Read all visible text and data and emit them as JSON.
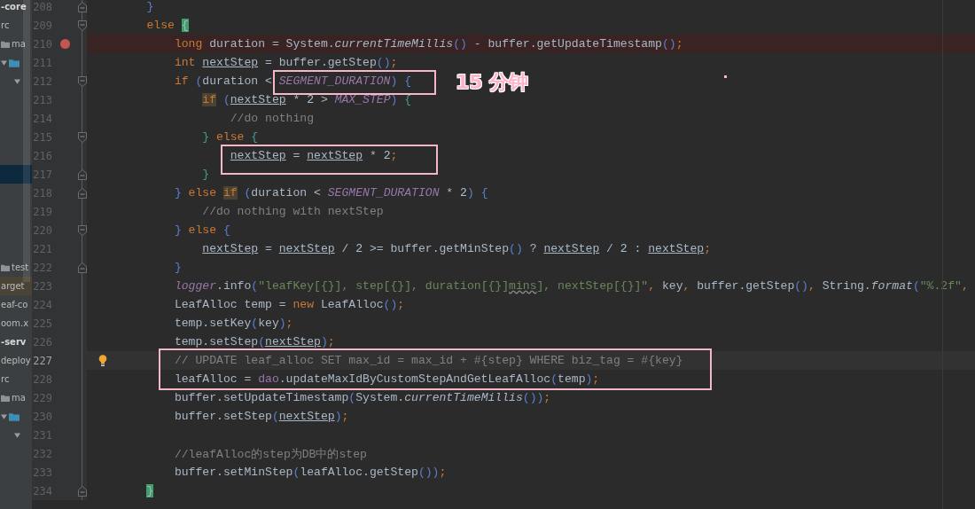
{
  "project_tree": [
    {
      "kind": "node",
      "text": "-core",
      "bold": true,
      "selected": false,
      "excluded": false
    },
    {
      "kind": "node",
      "text": "rc",
      "bold": false,
      "selected": false,
      "excluded": false
    },
    {
      "kind": "folder",
      "text": "ma",
      "bold": false,
      "selected": false,
      "excluded": false
    },
    {
      "kind": "expanded-folder",
      "selected": false,
      "excluded": false
    },
    {
      "kind": "expander",
      "selected": false,
      "excluded": false
    },
    {
      "kind": "blank",
      "selected": false,
      "excluded": false
    },
    {
      "kind": "blank",
      "selected": false,
      "excluded": false
    },
    {
      "kind": "blank",
      "selected": false,
      "excluded": false
    },
    {
      "kind": "blank",
      "selected": false,
      "excluded": false
    },
    {
      "kind": "blank",
      "selected": true,
      "excluded": false
    },
    {
      "kind": "blank",
      "selected": false,
      "excluded": false
    },
    {
      "kind": "blank",
      "selected": false,
      "excluded": false
    },
    {
      "kind": "blank",
      "selected": false,
      "excluded": false
    },
    {
      "kind": "blank",
      "selected": false,
      "excluded": false
    },
    {
      "kind": "folder",
      "text": "test",
      "bold": false,
      "selected": false,
      "excluded": false
    },
    {
      "kind": "node",
      "text": "arget",
      "bold": false,
      "selected": false,
      "excluded": true
    },
    {
      "kind": "node",
      "text": "eaf-co",
      "bold": false,
      "selected": false,
      "excluded": false
    },
    {
      "kind": "node",
      "text": "oom.x",
      "bold": false,
      "selected": false,
      "excluded": false
    },
    {
      "kind": "node",
      "text": "-serv",
      "bold": true,
      "selected": false,
      "excluded": false
    },
    {
      "kind": "node",
      "text": "deploy",
      "bold": false,
      "selected": false,
      "excluded": false
    },
    {
      "kind": "node",
      "text": "rc",
      "bold": false,
      "selected": false,
      "excluded": false
    },
    {
      "kind": "folder",
      "text": "ma",
      "bold": false,
      "selected": false,
      "excluded": false
    },
    {
      "kind": "expanded-folder",
      "selected": false,
      "excluded": false
    },
    {
      "kind": "expander",
      "selected": false,
      "excluded": false
    }
  ],
  "editor": {
    "lines": [
      {
        "number": "208",
        "fold_start": false,
        "fold_end": true,
        "tokens": [
          {
            "text": "    }",
            "kind": "bracket"
          }
        ]
      },
      {
        "number": "209",
        "fold_start": true,
        "fold_end": false,
        "tokens": [
          {
            "text": "    else ",
            "kind": "kw"
          },
          {
            "text": "{",
            "kind": "match"
          }
        ]
      },
      {
        "number": "210",
        "fold_start": false,
        "fold_end": false,
        "breakpoint": true,
        "tokens": [
          {
            "text": "        long",
            "kind": "kw"
          },
          {
            "text": " duration = System.",
            "kind": "plain"
          },
          {
            "text": "currentTimeMillis",
            "kind": "static"
          },
          {
            "text": "()",
            "kind": "bracket"
          },
          {
            "text": " - buffer.getUpdateTimestamp",
            "kind": "plain"
          },
          {
            "text": "()",
            "kind": "bracket"
          },
          {
            "text": ";",
            "kind": "punct"
          }
        ]
      },
      {
        "number": "211",
        "fold_start": false,
        "fold_end": false,
        "tokens": [
          {
            "text": "        int ",
            "kind": "kw"
          },
          {
            "text": "nextStep",
            "kind": "var"
          },
          {
            "text": " = buffer.getStep",
            "kind": "plain"
          },
          {
            "text": "()",
            "kind": "bracket"
          },
          {
            "text": ";",
            "kind": "punct"
          }
        ]
      },
      {
        "number": "212",
        "fold_start": true,
        "fold_end": false,
        "tokens": [
          {
            "text": "        if ",
            "kind": "kw"
          },
          {
            "text": "(",
            "kind": "bracket"
          },
          {
            "text": "duration < ",
            "kind": "plain"
          },
          {
            "text": "SEGMENT_DURATION",
            "kind": "const"
          },
          {
            "text": ")",
            "kind": "bracket"
          },
          {
            "text": " {",
            "kind": "bracket"
          }
        ]
      },
      {
        "number": "213",
        "fold_start": false,
        "fold_end": false,
        "tokens": [
          {
            "text": "            if",
            "kind": "kwhl"
          },
          {
            "text": " (",
            "kind": "bracket"
          },
          {
            "text": "nextStep",
            "kind": "var"
          },
          {
            "text": " * ",
            "kind": "plain"
          },
          {
            "text": "2",
            "kind": "num"
          },
          {
            "text": " > ",
            "kind": "plain"
          },
          {
            "text": "MAX_STEP",
            "kind": "const"
          },
          {
            "text": ")",
            "kind": "bracket"
          },
          {
            "text": " {",
            "kind": "green"
          }
        ]
      },
      {
        "number": "214",
        "fold_start": false,
        "fold_end": false,
        "tokens": [
          {
            "text": "                //do nothing",
            "kind": "comment"
          }
        ]
      },
      {
        "number": "215",
        "fold_start": true,
        "fold_end": false,
        "tokens": [
          {
            "text": "            }",
            "kind": "green"
          },
          {
            "text": " else ",
            "kind": "kw"
          },
          {
            "text": "{",
            "kind": "green"
          }
        ]
      },
      {
        "number": "216",
        "fold_start": false,
        "fold_end": false,
        "tokens": [
          {
            "text": "                nextStep",
            "kind": "var"
          },
          {
            "text": " = ",
            "kind": "plain"
          },
          {
            "text": "nextStep",
            "kind": "var"
          },
          {
            "text": " * ",
            "kind": "plain"
          },
          {
            "text": "2",
            "kind": "num"
          },
          {
            "text": ";",
            "kind": "punct"
          }
        ]
      },
      {
        "number": "217",
        "fold_start": false,
        "fold_end": true,
        "tokens": [
          {
            "text": "            }",
            "kind": "green"
          }
        ]
      },
      {
        "number": "218",
        "fold_start": false,
        "fold_end": true,
        "tokens": [
          {
            "text": "        } ",
            "kind": "bracket"
          },
          {
            "text": "else ",
            "kind": "kw"
          },
          {
            "text": "if",
            "kind": "kwhl"
          },
          {
            "text": " (",
            "kind": "bracket"
          },
          {
            "text": "duration < ",
            "kind": "plain"
          },
          {
            "text": "SEGMENT_DURATION",
            "kind": "const"
          },
          {
            "text": " * ",
            "kind": "plain"
          },
          {
            "text": "2",
            "kind": "num"
          },
          {
            "text": ")",
            "kind": "bracket"
          },
          {
            "text": " {",
            "kind": "bracket"
          }
        ]
      },
      {
        "number": "219",
        "fold_start": false,
        "fold_end": false,
        "tokens": [
          {
            "text": "            //do nothing with nextStep",
            "kind": "comment"
          }
        ]
      },
      {
        "number": "220",
        "fold_start": true,
        "fold_end": false,
        "tokens": [
          {
            "text": "        } ",
            "kind": "bracket"
          },
          {
            "text": "else ",
            "kind": "kw"
          },
          {
            "text": "{",
            "kind": "bracket"
          }
        ]
      },
      {
        "number": "221",
        "fold_start": false,
        "fold_end": false,
        "tokens": [
          {
            "text": "            nextStep",
            "kind": "var"
          },
          {
            "text": " = ",
            "kind": "plain"
          },
          {
            "text": "nextStep",
            "kind": "var"
          },
          {
            "text": " / ",
            "kind": "plain"
          },
          {
            "text": "2",
            "kind": "num"
          },
          {
            "text": " >= buffer.getMinStep",
            "kind": "plain"
          },
          {
            "text": "()",
            "kind": "bracket"
          },
          {
            "text": " ? ",
            "kind": "plain"
          },
          {
            "text": "nextStep",
            "kind": "var"
          },
          {
            "text": " / ",
            "kind": "plain"
          },
          {
            "text": "2",
            "kind": "num"
          },
          {
            "text": " : ",
            "kind": "plain"
          },
          {
            "text": "nextStep",
            "kind": "var"
          },
          {
            "text": ";",
            "kind": "punct"
          }
        ]
      },
      {
        "number": "222",
        "fold_start": false,
        "fold_end": true,
        "tokens": [
          {
            "text": "        }",
            "kind": "bracket"
          }
        ]
      },
      {
        "number": "223",
        "fold_start": false,
        "fold_end": false,
        "tokens": [
          {
            "text": "        logger",
            "kind": "field"
          },
          {
            "text": ".info",
            "kind": "plain"
          },
          {
            "text": "(",
            "kind": "bracket"
          },
          {
            "text": "\"leafKey[{}], step[{}], duration[{}]",
            "kind": "str"
          },
          {
            "text": "mins",
            "kind": "strwarn"
          },
          {
            "text": "], nextStep[{}]\"",
            "kind": "str"
          },
          {
            "text": ",",
            "kind": "punct"
          },
          {
            "text": " key",
            "kind": "plain"
          },
          {
            "text": ",",
            "kind": "punct"
          },
          {
            "text": " buffer.getStep",
            "kind": "plain"
          },
          {
            "text": "()",
            "kind": "bracket"
          },
          {
            "text": ",",
            "kind": "punct"
          },
          {
            "text": " String.",
            "kind": "plain"
          },
          {
            "text": "format",
            "kind": "static"
          },
          {
            "text": "(",
            "kind": "bracket"
          },
          {
            "text": "\"%.2f\"",
            "kind": "str"
          },
          {
            "text": ",",
            "kind": "punct"
          }
        ]
      },
      {
        "number": "224",
        "fold_start": false,
        "fold_end": false,
        "tokens": [
          {
            "text": "        LeafAlloc temp = ",
            "kind": "plain"
          },
          {
            "text": "new",
            "kind": "kw"
          },
          {
            "text": " LeafAlloc",
            "kind": "plain"
          },
          {
            "text": "()",
            "kind": "bracket"
          },
          {
            "text": ";",
            "kind": "punct"
          }
        ]
      },
      {
        "number": "225",
        "fold_start": false,
        "fold_end": false,
        "tokens": [
          {
            "text": "        temp.setKey",
            "kind": "plain"
          },
          {
            "text": "(",
            "kind": "bracket"
          },
          {
            "text": "key",
            "kind": "plain"
          },
          {
            "text": ")",
            "kind": "bracket"
          },
          {
            "text": ";",
            "kind": "punct"
          }
        ]
      },
      {
        "number": "226",
        "fold_start": false,
        "fold_end": false,
        "tokens": [
          {
            "text": "        temp.setStep",
            "kind": "plain"
          },
          {
            "text": "(",
            "kind": "bracket"
          },
          {
            "text": "nextStep",
            "kind": "var"
          },
          {
            "text": ")",
            "kind": "bracket"
          },
          {
            "text": ";",
            "kind": "punct"
          }
        ]
      },
      {
        "number": "227",
        "fold_start": false,
        "fold_end": false,
        "current": true,
        "intention": true,
        "tokens": [
          {
            "text": "        // UPDATE leaf_alloc SET max_id = max_id + #{step} WHERE biz_tag = #{key}",
            "kind": "comment"
          }
        ]
      },
      {
        "number": "228",
        "fold_start": false,
        "fold_end": false,
        "tokens": [
          {
            "text": "        leafAlloc = ",
            "kind": "plain"
          },
          {
            "text": "dao",
            "kind": "fieldplain"
          },
          {
            "text": ".updateMaxIdByCustomStepAndGetLeafAlloc",
            "kind": "plain"
          },
          {
            "text": "(",
            "kind": "bracket"
          },
          {
            "text": "temp",
            "kind": "plain"
          },
          {
            "text": ")",
            "kind": "bracket"
          },
          {
            "text": ";",
            "kind": "punct"
          }
        ]
      },
      {
        "number": "229",
        "fold_start": false,
        "fold_end": false,
        "tokens": [
          {
            "text": "        buffer.setUpdateTimestamp",
            "kind": "plain"
          },
          {
            "text": "(",
            "kind": "bracket"
          },
          {
            "text": "System.",
            "kind": "plain"
          },
          {
            "text": "currentTimeMillis",
            "kind": "static"
          },
          {
            "text": "())",
            "kind": "bracket"
          },
          {
            "text": ";",
            "kind": "punct"
          }
        ]
      },
      {
        "number": "230",
        "fold_start": false,
        "fold_end": false,
        "tokens": [
          {
            "text": "        buffer.setStep",
            "kind": "plain"
          },
          {
            "text": "(",
            "kind": "bracket"
          },
          {
            "text": "nextStep",
            "kind": "var"
          },
          {
            "text": ")",
            "kind": "bracket"
          },
          {
            "text": ";",
            "kind": "punct"
          }
        ]
      },
      {
        "number": "231",
        "fold_start": false,
        "fold_end": false
      },
      {
        "number": "232",
        "fold_start": false,
        "fold_end": false,
        "tokens": [
          {
            "text": "        //leafAlloc的step为DB中的step",
            "kind": "comment"
          }
        ]
      },
      {
        "number": "233",
        "fold_start": false,
        "fold_end": false,
        "tokens": [
          {
            "text": "        buffer.setMinStep",
            "kind": "plain"
          },
          {
            "text": "(",
            "kind": "bracket"
          },
          {
            "text": "leafAlloc.getStep",
            "kind": "plain"
          },
          {
            "text": "())",
            "kind": "bracket"
          },
          {
            "text": ";",
            "kind": "punct"
          }
        ]
      },
      {
        "number": "234",
        "fold_start": false,
        "fold_end": true,
        "tokens": [
          {
            "text": "    }",
            "kind": "match"
          }
        ]
      }
    ]
  },
  "annotation": {
    "label": "15 分钟",
    "dot": true
  }
}
